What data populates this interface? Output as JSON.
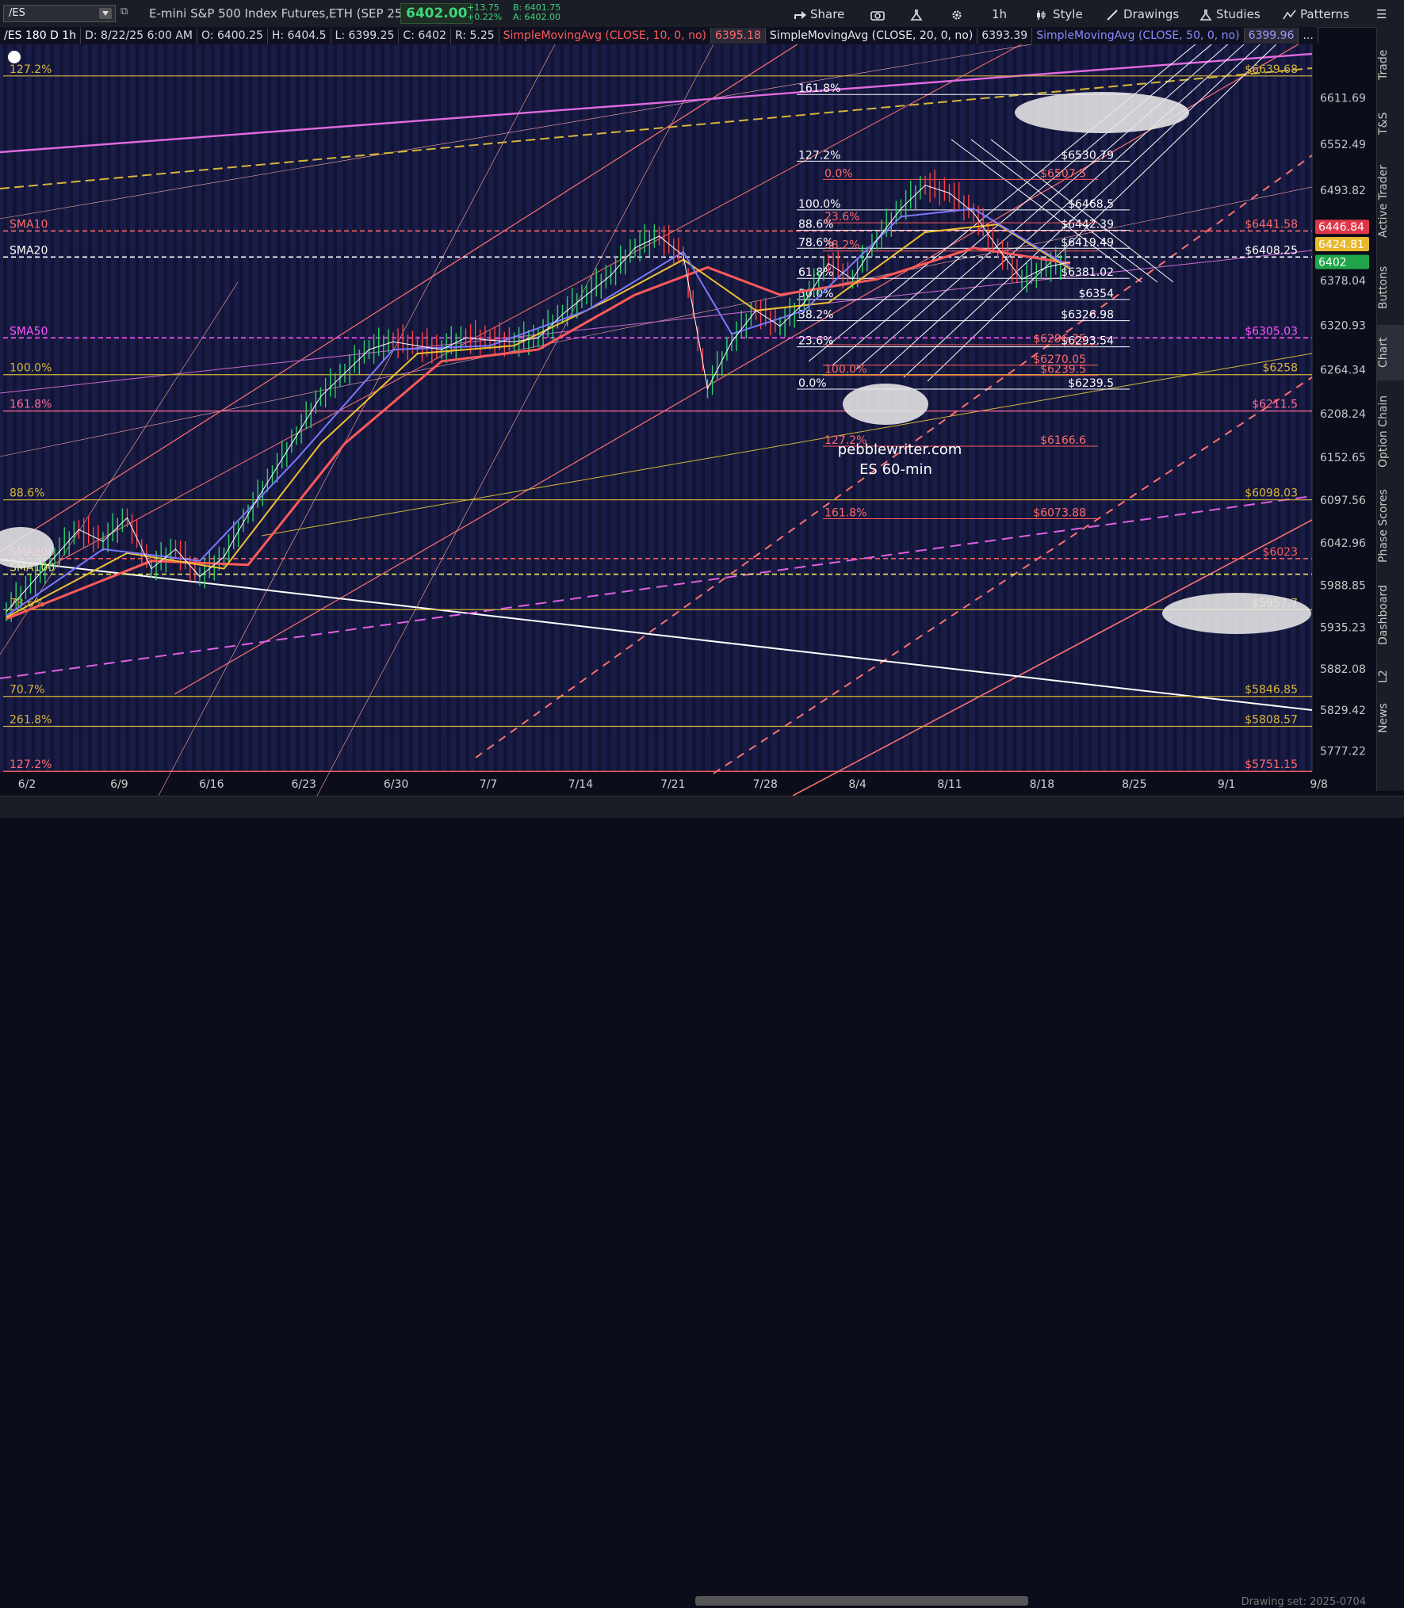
{
  "toolbar": {
    "symbol": "/ES",
    "instrument": "E-mini S&P 500 Index Futures,ETH (SEP 25)",
    "last": "6402.00",
    "change": "+13.75",
    "change_pct": "+0.22%",
    "bid": "B: 6401.75",
    "ask": "A: 6402.00",
    "share": "Share",
    "interval": "1h",
    "style": "Style",
    "drawings": "Drawings",
    "studies": "Studies",
    "patterns": "Patterns"
  },
  "header": {
    "symbol_tf": "/ES 180 D 1h",
    "date": "D: 8/22/25 6:00 AM",
    "open": "O: 6400.25",
    "high": "H: 6404.5",
    "low": "L: 6399.25",
    "close": "C: 6402",
    "range": "R: 5.25",
    "sma10": "SimpleMovingAvg (CLOSE, 10, 0, no)",
    "sma10_val": "6395.18",
    "sma20": "SimpleMovingAvg (CLOSE, 20, 0, no)",
    "sma20_val": "6393.39",
    "sma50": "SimpleMovingAvg (CLOSE, 50, 0, no)",
    "sma50_val": "6399.96",
    "more": "..."
  },
  "sidebar": [
    "Trade",
    "T&S",
    "Active Trader",
    "Buttons",
    "Chart",
    "Option Chain",
    "Phase Scores",
    "Dashboard",
    "L2",
    "News"
  ],
  "bottom": {
    "drawing_set": "Drawing set: 2025-0704"
  },
  "chart_data": {
    "type": "line",
    "title": "",
    "watermark": [
      "pebblewriter.com",
      "ES 60-min"
    ],
    "x_ticks": [
      "6/2",
      "6/9",
      "6/16",
      "6/23",
      "6/30",
      "7/7",
      "7/14",
      "7/21",
      "7/28",
      "8/4",
      "8/11",
      "8/18",
      "8/25",
      "9/1",
      "9/8"
    ],
    "y_ticks": [
      "6611.69",
      "6552.49",
      "6493.82",
      "6378.04",
      "6320.93",
      "6264.34",
      "6208.24",
      "6152.65",
      "6097.56",
      "6042.96",
      "5988.85",
      "5935.23",
      "5882.08",
      "5829.42",
      "5777.22"
    ],
    "ylim": [
      5720,
      6680
    ],
    "price_labels": [
      {
        "text": "6446.84",
        "value": 6446.84,
        "color": "#e0364a"
      },
      {
        "text": "6424.81",
        "value": 6424.81,
        "color": "#e6b92e"
      },
      {
        "text": "6402",
        "value": 6402,
        "color": "#1fa64a"
      }
    ],
    "horizontal_levels": [
      {
        "left": "127.2%",
        "right": "$6639.68",
        "value": 6639.68,
        "color": "#d6b63a"
      },
      {
        "left": "SMA10",
        "right": "$6441.58",
        "value": 6441.58,
        "color": "#ff6a6a",
        "dashed": true
      },
      {
        "left": "SMA20",
        "right": "$6408.25",
        "value": 6408.25,
        "color": "#ffffff",
        "dashed": true
      },
      {
        "left": "SMA50",
        "right": "$6305.03",
        "value": 6305.03,
        "color": "#ff55ff",
        "dashed": true
      },
      {
        "left": "100.0%",
        "right": "$6258",
        "value": 6258,
        "color": "#d6b63a"
      },
      {
        "left": "161.8%",
        "right": "$6211.5",
        "value": 6211.5,
        "color": "#ff6a9a"
      },
      {
        "left": "88.6%",
        "right": "$6098.03",
        "value": 6098.03,
        "color": "#d6b63a"
      },
      {
        "left": "SMA200",
        "right": "$6023",
        "value": 6023,
        "color": "#ff5a5a",
        "dashed": true
      },
      {
        "left": "SMA100",
        "right": "",
        "value": 6003,
        "color": "#e6e65a",
        "dashed": true
      },
      {
        "left": "78.6%",
        "right": "$5957.7",
        "value": 5957.7,
        "color": "#d6b63a"
      },
      {
        "left": "70.7%",
        "right": "$5846.85",
        "value": 5846.85,
        "color": "#d6b63a"
      },
      {
        "left": "261.8%",
        "right": "$5808.57",
        "value": 5808.57,
        "color": "#d6b63a"
      },
      {
        "left": "127.2%",
        "right": "$5751.15",
        "value": 5751.15,
        "color": "#ff6a6a"
      }
    ],
    "fib_white": [
      {
        "pct": "161.8%",
        "price": "",
        "value": 6616
      },
      {
        "pct": "127.2%",
        "price": "$6530.79",
        "value": 6530.79
      },
      {
        "pct": "100.0%",
        "price": "$6468.5",
        "value": 6468.5
      },
      {
        "pct": "88.6%",
        "price": "$6442.39",
        "value": 6442.39
      },
      {
        "pct": "78.6%",
        "price": "$6419.49",
        "value": 6419.49
      },
      {
        "pct": "61.8%",
        "price": "$6381.02",
        "value": 6381.02
      },
      {
        "pct": "50.0%",
        "price": "$6354",
        "value": 6354
      },
      {
        "pct": "38.2%",
        "price": "$6326.98",
        "value": 6326.98
      },
      {
        "pct": "23.6%",
        "price": "$6293.54",
        "value": 6293.54
      },
      {
        "pct": "0.0%",
        "price": "$6239.5",
        "value": 6239.5
      }
    ],
    "fib_red": [
      {
        "pct": "0.0%",
        "price": "$6507.5",
        "value": 6507.5
      },
      {
        "pct": "23.6%",
        "price": "",
        "value": 6452
      },
      {
        "pct": "38.2%",
        "price": "",
        "value": 6416
      },
      {
        "pct": "",
        "price": "$6296.25",
        "value": 6296.25
      },
      {
        "pct": "",
        "price": "$6270.05",
        "value": 6270.05
      },
      {
        "pct": "100.0%",
        "price": "$6239.5",
        "value": 6257
      },
      {
        "pct": "127.2%",
        "price": "$6166.6",
        "value": 6166.6
      },
      {
        "pct": "161.8%",
        "price": "$6073.88",
        "value": 6073.88
      }
    ],
    "series": [
      {
        "name": "SimpleMovingAvg (CLOSE, 10, 0, no)",
        "color": "#ffffff"
      },
      {
        "name": "SimpleMovingAvg (CLOSE, 20, 0, no)",
        "color": "#f0c030"
      },
      {
        "name": "SimpleMovingAvg (CLOSE, 50, 0, no)",
        "color": "#7a7aff"
      }
    ],
    "price_path": [
      [
        0,
        5955
      ],
      [
        1,
        5990
      ],
      [
        2,
        6025
      ],
      [
        3,
        6060
      ],
      [
        4,
        6045
      ],
      [
        5,
        6075
      ],
      [
        6,
        6010
      ],
      [
        7,
        6035
      ],
      [
        8,
        6000
      ],
      [
        9,
        6025
      ],
      [
        10,
        6080
      ],
      [
        11,
        6130
      ],
      [
        12,
        6180
      ],
      [
        13,
        6230
      ],
      [
        14,
        6260
      ],
      [
        15,
        6290
      ],
      [
        16,
        6300
      ],
      [
        17,
        6295
      ],
      [
        18,
        6290
      ],
      [
        19,
        6305
      ],
      [
        20,
        6302
      ],
      [
        21,
        6300
      ],
      [
        22,
        6305
      ],
      [
        23,
        6335
      ],
      [
        24,
        6360
      ],
      [
        25,
        6385
      ],
      [
        26,
        6420
      ],
      [
        27,
        6435
      ],
      [
        28,
        6410
      ],
      [
        29,
        6240
      ],
      [
        30,
        6300
      ],
      [
        31,
        6340
      ],
      [
        32,
        6320
      ],
      [
        33,
        6350
      ],
      [
        34,
        6400
      ],
      [
        35,
        6380
      ],
      [
        36,
        6430
      ],
      [
        37,
        6470
      ],
      [
        38,
        6500
      ],
      [
        39,
        6490
      ],
      [
        40,
        6465
      ],
      [
        41,
        6420
      ],
      [
        42,
        6380
      ],
      [
        43,
        6395
      ],
      [
        44,
        6402
      ]
    ],
    "sma10_path": [
      [
        0,
        5950
      ],
      [
        4,
        6035
      ],
      [
        8,
        6020
      ],
      [
        12,
        6150
      ],
      [
        16,
        6290
      ],
      [
        20,
        6295
      ],
      [
        24,
        6340
      ],
      [
        28,
        6415
      ],
      [
        30,
        6310
      ],
      [
        33,
        6340
      ],
      [
        37,
        6460
      ],
      [
        40,
        6470
      ],
      [
        44,
        6395
      ]
    ],
    "sma20_path": [
      [
        0,
        5948
      ],
      [
        5,
        6030
      ],
      [
        9,
        6010
      ],
      [
        13,
        6170
      ],
      [
        17,
        6285
      ],
      [
        21,
        6295
      ],
      [
        25,
        6355
      ],
      [
        28,
        6405
      ],
      [
        31,
        6340
      ],
      [
        34,
        6350
      ],
      [
        38,
        6440
      ],
      [
        41,
        6450
      ],
      [
        44,
        6393
      ]
    ],
    "sma50_path": [
      [
        0,
        5946
      ],
      [
        6,
        6020
      ],
      [
        10,
        6015
      ],
      [
        14,
        6170
      ],
      [
        18,
        6275
      ],
      [
        22,
        6290
      ],
      [
        26,
        6360
      ],
      [
        29,
        6395
      ],
      [
        32,
        6360
      ],
      [
        36,
        6380
      ],
      [
        40,
        6420
      ],
      [
        44,
        6400
      ]
    ]
  }
}
